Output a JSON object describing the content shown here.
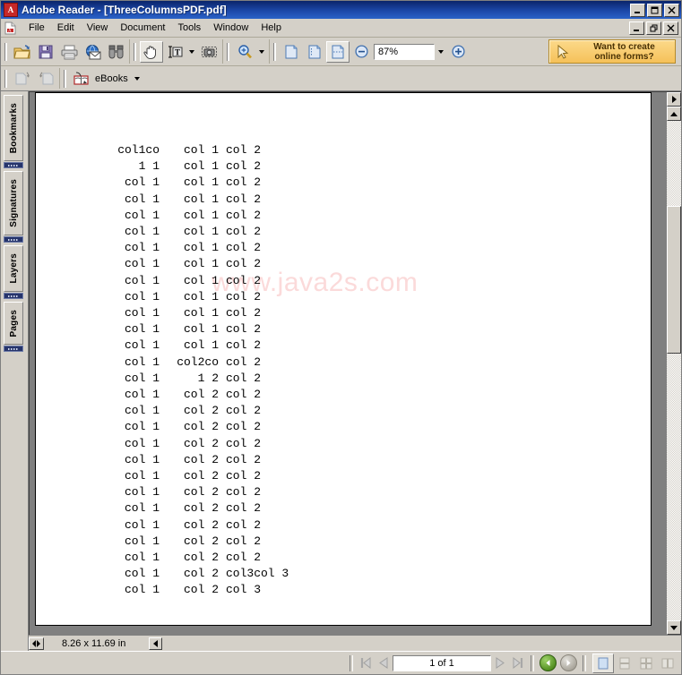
{
  "window": {
    "title": "Adobe Reader - [ThreeColumnsPDF.pdf]",
    "app_icon": "adobe-reader-icon",
    "outer_controls": [
      {
        "name": "minimize",
        "glyph": "_"
      },
      {
        "name": "maximize",
        "glyph": "□"
      },
      {
        "name": "close",
        "glyph": "X"
      }
    ],
    "inner_controls": [
      {
        "name": "minimize",
        "glyph": "_"
      },
      {
        "name": "restore",
        "glyph": "❐"
      },
      {
        "name": "close",
        "glyph": "X"
      }
    ]
  },
  "menubar": {
    "items": [
      "File",
      "Edit",
      "View",
      "Document",
      "Tools",
      "Window",
      "Help"
    ]
  },
  "toolbar": {
    "file_group": [
      {
        "name": "open-file-button",
        "icon": "open-folder-icon"
      },
      {
        "name": "save-button",
        "icon": "floppy-disk-icon"
      },
      {
        "name": "print-button",
        "icon": "printer-icon"
      },
      {
        "name": "email-button",
        "icon": "globe-envelope-icon"
      },
      {
        "name": "search-button",
        "icon": "binoculars-icon"
      }
    ],
    "tool_group": [
      {
        "name": "hand-tool-button",
        "icon": "hand-icon",
        "pressed": true
      },
      {
        "name": "select-text-button",
        "icon": "text-select-icon",
        "pressed": false
      },
      {
        "name": "snapshot-button",
        "icon": "camera-icon",
        "pressed": false
      }
    ],
    "zoom_group": {
      "zoom_tool": {
        "name": "zoom-tool-button",
        "icon": "magnifier-icon"
      },
      "zoom_out": {
        "name": "zoom-out-button",
        "icon": "minus-circle-icon"
      },
      "zoom_in": {
        "name": "zoom-in-button",
        "icon": "plus-circle-icon"
      },
      "zoom_value": "87%"
    },
    "view_group": [
      {
        "name": "actual-size-button",
        "icon": "page-icon"
      },
      {
        "name": "fit-page-button",
        "icon": "fit-page-icon"
      },
      {
        "name": "fit-width-button",
        "icon": "fit-width-icon",
        "pressed": true
      }
    ],
    "promo": {
      "line1": "Want to create",
      "line2": "online forms?",
      "icon": "cursor-arrow-icon"
    }
  },
  "toolbar2": {
    "nav_buttons": [
      {
        "name": "previous-view-button",
        "icon": "page-forward-icon",
        "disabled": true
      },
      {
        "name": "next-view-button",
        "icon": "page-back-icon",
        "disabled": true
      }
    ],
    "ebooks": {
      "label": "eBooks",
      "icon": "ebooks-icon"
    }
  },
  "navigation_rail": {
    "tabs": [
      {
        "name": "bookmarks-tab",
        "label": "Bookmarks"
      },
      {
        "name": "signatures-tab",
        "label": "Signatures"
      },
      {
        "name": "layers-tab",
        "label": "Layers"
      },
      {
        "name": "pages-tab",
        "label": "Pages"
      }
    ]
  },
  "document": {
    "watermark": "www.java2s.com",
    "page_size": "8.26 x 11.69 in",
    "rows": [
      {
        "c1": "col1co",
        "c2": "col 1",
        "c3": "col 2"
      },
      {
        "c1": "1 1",
        "c2": "col 1",
        "c3": "col 2"
      },
      {
        "c1": "col 1",
        "c2": "col 1",
        "c3": "col 2"
      },
      {
        "c1": "col 1",
        "c2": "col 1",
        "c3": "col 2"
      },
      {
        "c1": "col 1",
        "c2": "col 1",
        "c3": "col 2"
      },
      {
        "c1": "col 1",
        "c2": "col 1",
        "c3": "col 2"
      },
      {
        "c1": "col 1",
        "c2": "col 1",
        "c3": "col 2"
      },
      {
        "c1": "col 1",
        "c2": "col 1",
        "c3": "col 2"
      },
      {
        "c1": "col 1",
        "c2": "col 1",
        "c3": "col 2"
      },
      {
        "c1": "col 1",
        "c2": "col 1",
        "c3": "col 2"
      },
      {
        "c1": "col 1",
        "c2": "col 1",
        "c3": "col 2"
      },
      {
        "c1": "col 1",
        "c2": "col 1",
        "c3": "col 2"
      },
      {
        "c1": "col 1",
        "c2": "col 1",
        "c3": "col 2"
      },
      {
        "c1": "col 1",
        "c2": "col2co",
        "c3": "col 2"
      },
      {
        "c1": "col 1",
        "c2": "1 2",
        "c3": "col 2"
      },
      {
        "c1": "col 1",
        "c2": "col 2",
        "c3": "col 2"
      },
      {
        "c1": "col 1",
        "c2": "col 2",
        "c3": "col 2"
      },
      {
        "c1": "col 1",
        "c2": "col 2",
        "c3": "col 2"
      },
      {
        "c1": "col 1",
        "c2": "col 2",
        "c3": "col 2"
      },
      {
        "c1": "col 1",
        "c2": "col 2",
        "c3": "col 2"
      },
      {
        "c1": "col 1",
        "c2": "col 2",
        "c3": "col 2"
      },
      {
        "c1": "col 1",
        "c2": "col 2",
        "c3": "col 2"
      },
      {
        "c1": "col 1",
        "c2": "col 2",
        "c3": "col 2"
      },
      {
        "c1": "col 1",
        "c2": "col 2",
        "c3": "col 2"
      },
      {
        "c1": "col 1",
        "c2": "col 2",
        "c3": "col 2"
      },
      {
        "c1": "col 1",
        "c2": "col 2",
        "c3": "col 2"
      },
      {
        "c1": "col 1",
        "c2": "col 2",
        "c3": "col3col 3"
      },
      {
        "c1": "col 1",
        "c2": "col 2",
        "c3": "col 3"
      }
    ]
  },
  "statusbar": {
    "first_page_button": {
      "name": "first-page-button",
      "icon": "first-page-icon",
      "disabled": true
    },
    "prev_page_button": {
      "name": "previous-page-button",
      "icon": "previous-page-icon",
      "disabled": true
    },
    "page_indicator": "1 of 1",
    "next_page_button": {
      "name": "next-page-button",
      "icon": "next-page-icon",
      "disabled": true
    },
    "last_page_button": {
      "name": "last-page-button",
      "icon": "last-page-icon",
      "disabled": true
    },
    "back_button": {
      "name": "go-back-button",
      "icon": "back-arrow-icon",
      "enabled": true
    },
    "forward_button": {
      "name": "go-forward-button",
      "icon": "forward-arrow-icon",
      "enabled": false
    },
    "layout_buttons": [
      {
        "name": "single-page-layout-button",
        "icon": "single-page-icon",
        "active": true
      },
      {
        "name": "continuous-layout-button",
        "icon": "continuous-page-icon",
        "active": false
      },
      {
        "name": "facing-layout-button",
        "icon": "facing-pages-icon",
        "active": false
      },
      {
        "name": "continuous-facing-layout-button",
        "icon": "continuous-facing-icon",
        "active": false
      }
    ]
  },
  "colors": {
    "titlebar_blue": "#0a246a",
    "chrome_grey": "#d4d0c8",
    "watermark_pink": "#fbdada",
    "promo_gold": "#f5c159"
  }
}
